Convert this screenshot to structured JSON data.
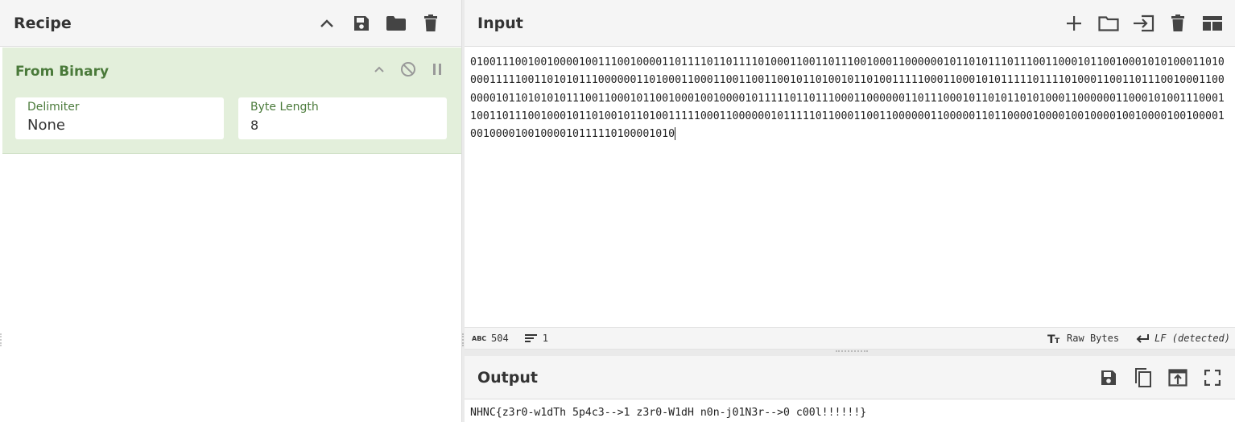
{
  "recipe": {
    "title": "Recipe",
    "header_icons": [
      "chevron-up-icon",
      "save-icon",
      "folder-icon",
      "trash-icon"
    ],
    "operation": {
      "name": "From Binary",
      "fields": [
        {
          "label": "Delimiter",
          "value": "None"
        },
        {
          "label": "Byte Length",
          "value": "8"
        }
      ]
    }
  },
  "input": {
    "title": "Input",
    "text": "010011100100100001001110010000110111101101111010001100110111001000110000001011010111011100110001011001000101010001101000011111001101010111000000110100011000110011001100101101001011010011111000110001010111110111101000110011011100100011000000101101010101110011000101100100010010000101111101101110001100000011011100010110101101010001100000011000101001110001100110111001000101101001011010011111000110000001011111011000110011000000110000011011000010000100100001001000010010000100100001001000010111110100001010",
    "status": {
      "chars_label": "504",
      "lines_label": "1",
      "encoding": "Raw Bytes",
      "eol": "LF (detected)"
    }
  },
  "output": {
    "title": "Output",
    "text": "NHNC{z3r0-w1dTh 5p4c3-->1 z3r0-W1dH n0n-j01N3r-->0 c00l!!!!!!}"
  },
  "colors": {
    "op_background": "#e3efdb",
    "op_accent": "#4a7a3a",
    "header_background": "#f5f5f5"
  }
}
